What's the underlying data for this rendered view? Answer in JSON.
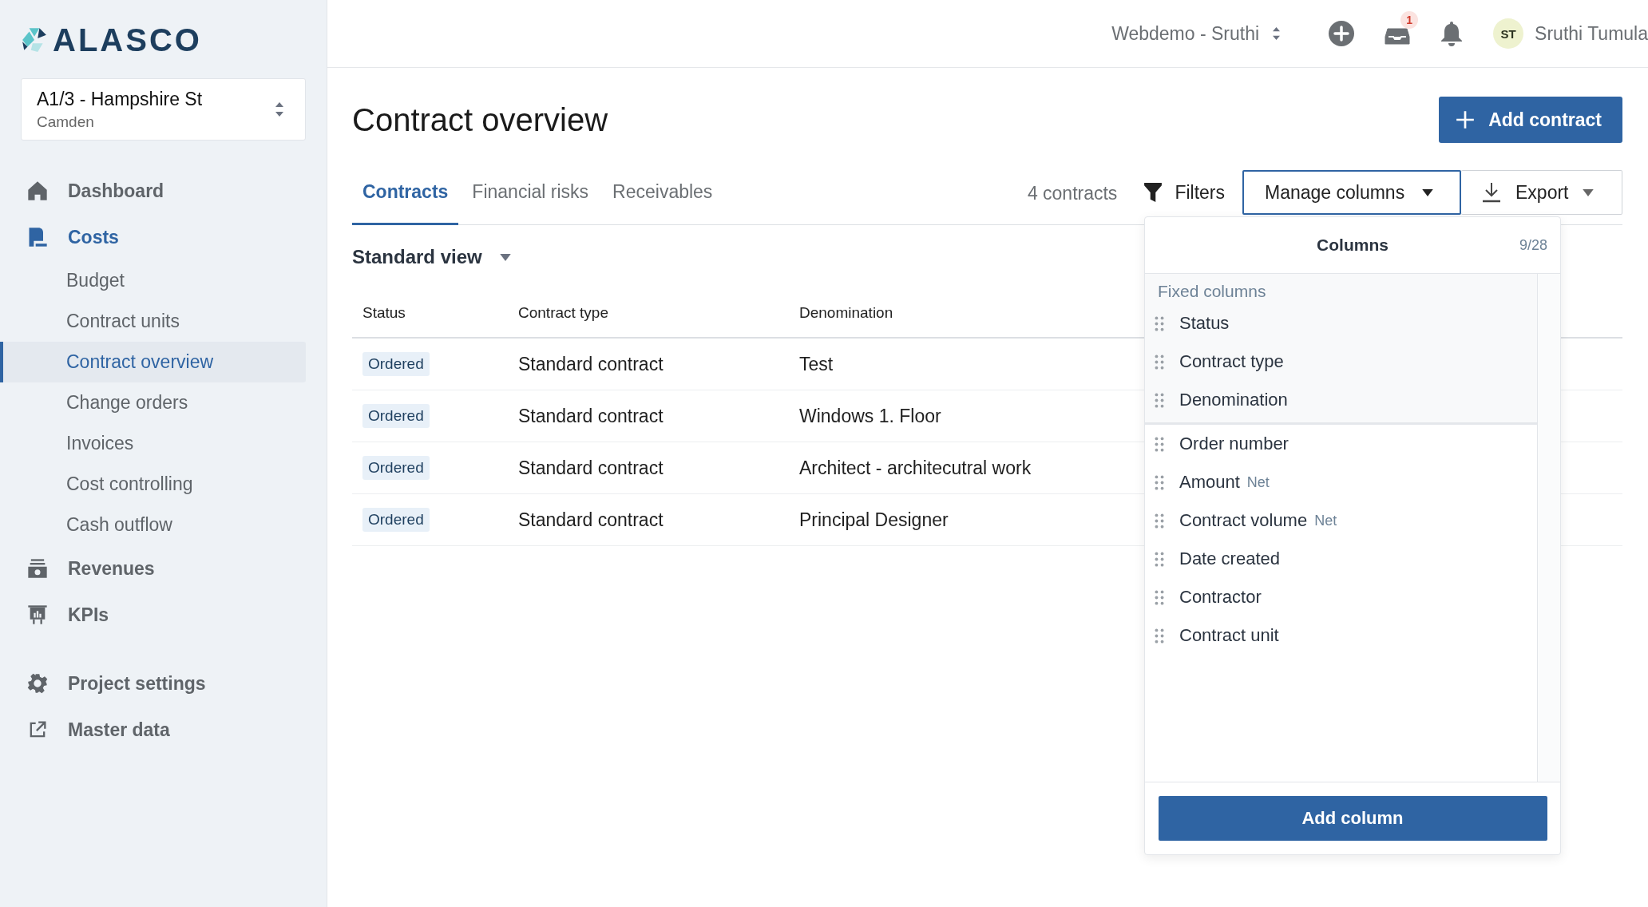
{
  "sidebar": {
    "logo": "ALASCO",
    "project": {
      "name": "A1/3 - Hampshire St",
      "location": "Camden"
    },
    "nav": [
      {
        "label": "Dashboard",
        "selected": false
      },
      {
        "label": "Costs",
        "selected": true,
        "children": [
          {
            "label": "Budget",
            "selected": false
          },
          {
            "label": "Contract units",
            "selected": false
          },
          {
            "label": "Contract overview",
            "selected": true
          },
          {
            "label": "Change orders",
            "selected": false
          },
          {
            "label": "Invoices",
            "selected": false
          },
          {
            "label": "Cost controlling",
            "selected": false
          },
          {
            "label": "Cash outflow",
            "selected": false
          }
        ]
      },
      {
        "label": "Revenues",
        "selected": false
      },
      {
        "label": "KPIs",
        "selected": false
      }
    ],
    "bottom_nav": [
      {
        "label": "Project settings"
      },
      {
        "label": "Master data"
      }
    ]
  },
  "topbar": {
    "workspace": "Webdemo - Sruthi",
    "inbox_badge": "1",
    "user_initials": "ST",
    "user_name": "Sruthi Tumula"
  },
  "page": {
    "title": "Contract overview",
    "add_button": "Add contract",
    "tabs": [
      {
        "label": "Contracts",
        "selected": true
      },
      {
        "label": "Financial risks",
        "selected": false
      },
      {
        "label": "Receivables",
        "selected": false
      }
    ],
    "count": "4 contracts",
    "filters": "Filters",
    "manage_columns": {
      "label": "Manage columns",
      "open": true
    },
    "export": "Export",
    "view": "Standard view",
    "table": {
      "columns": [
        "Status",
        "Contract type",
        "Denomination"
      ],
      "rows": [
        {
          "status": "Ordered",
          "contract_type": "Standard contract",
          "denomination": "Test"
        },
        {
          "status": "Ordered",
          "contract_type": "Standard contract",
          "denomination": "Windows 1. Floor"
        },
        {
          "status": "Ordered",
          "contract_type": "Standard contract",
          "denomination": "Architect - architecutral work"
        },
        {
          "status": "Ordered",
          "contract_type": "Standard contract",
          "denomination": "Principal Designer"
        }
      ]
    },
    "columns_panel": {
      "title": "Columns",
      "count": "9/28",
      "fixed_heading": "Fixed columns",
      "fixed": [
        {
          "label": "Status"
        },
        {
          "label": "Contract type"
        },
        {
          "label": "Denomination"
        }
      ],
      "other": [
        {
          "label": "Order number"
        },
        {
          "label": "Amount",
          "note": "Net"
        },
        {
          "label": "Contract volume",
          "note": "Net"
        },
        {
          "label": "Date created"
        },
        {
          "label": "Contractor"
        },
        {
          "label": "Contract unit"
        }
      ],
      "add_button": "Add column"
    }
  }
}
